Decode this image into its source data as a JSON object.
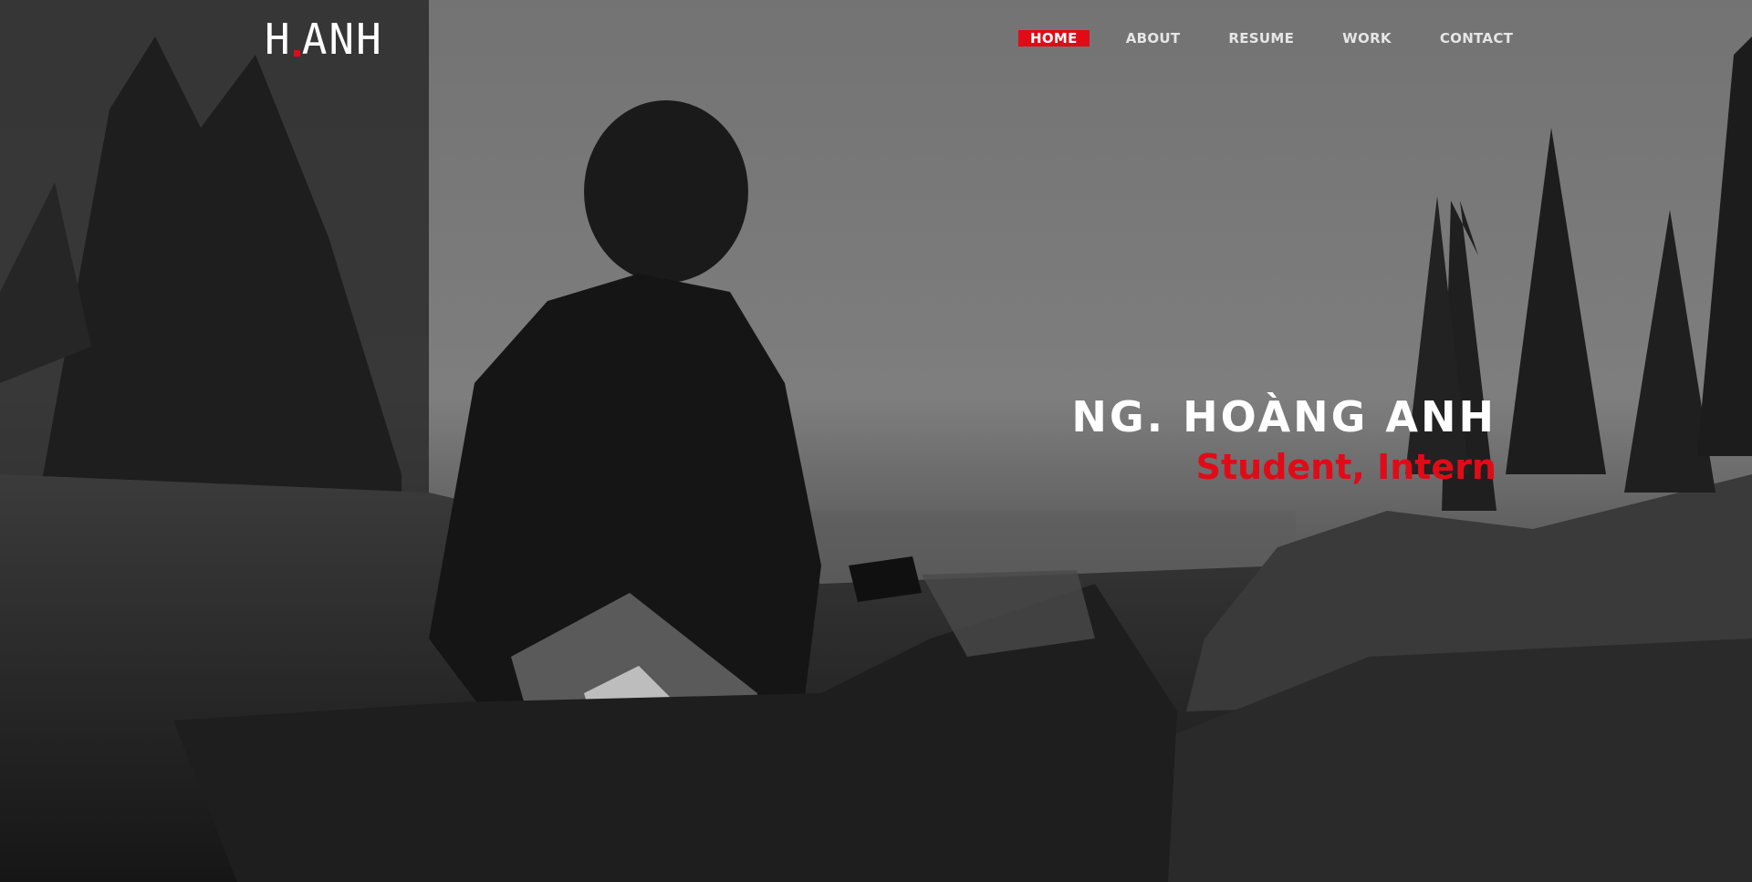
{
  "logo": {
    "text_left": "H",
    "text_right": "ANH",
    "accent": "#e10b17"
  },
  "nav": {
    "items": [
      {
        "label": "HOME",
        "active": true
      },
      {
        "label": "ABOUT",
        "active": false
      },
      {
        "label": "RESUME",
        "active": false
      },
      {
        "label": "WORK",
        "active": false
      },
      {
        "label": "CONTACT",
        "active": false
      }
    ]
  },
  "hero": {
    "name": "NG. HOÀNG ANH",
    "role": "Student, Intern",
    "background": "grayscale photo of person sitting on motorcycle near pine trees and coastline",
    "accent_color": "#e10b17"
  }
}
